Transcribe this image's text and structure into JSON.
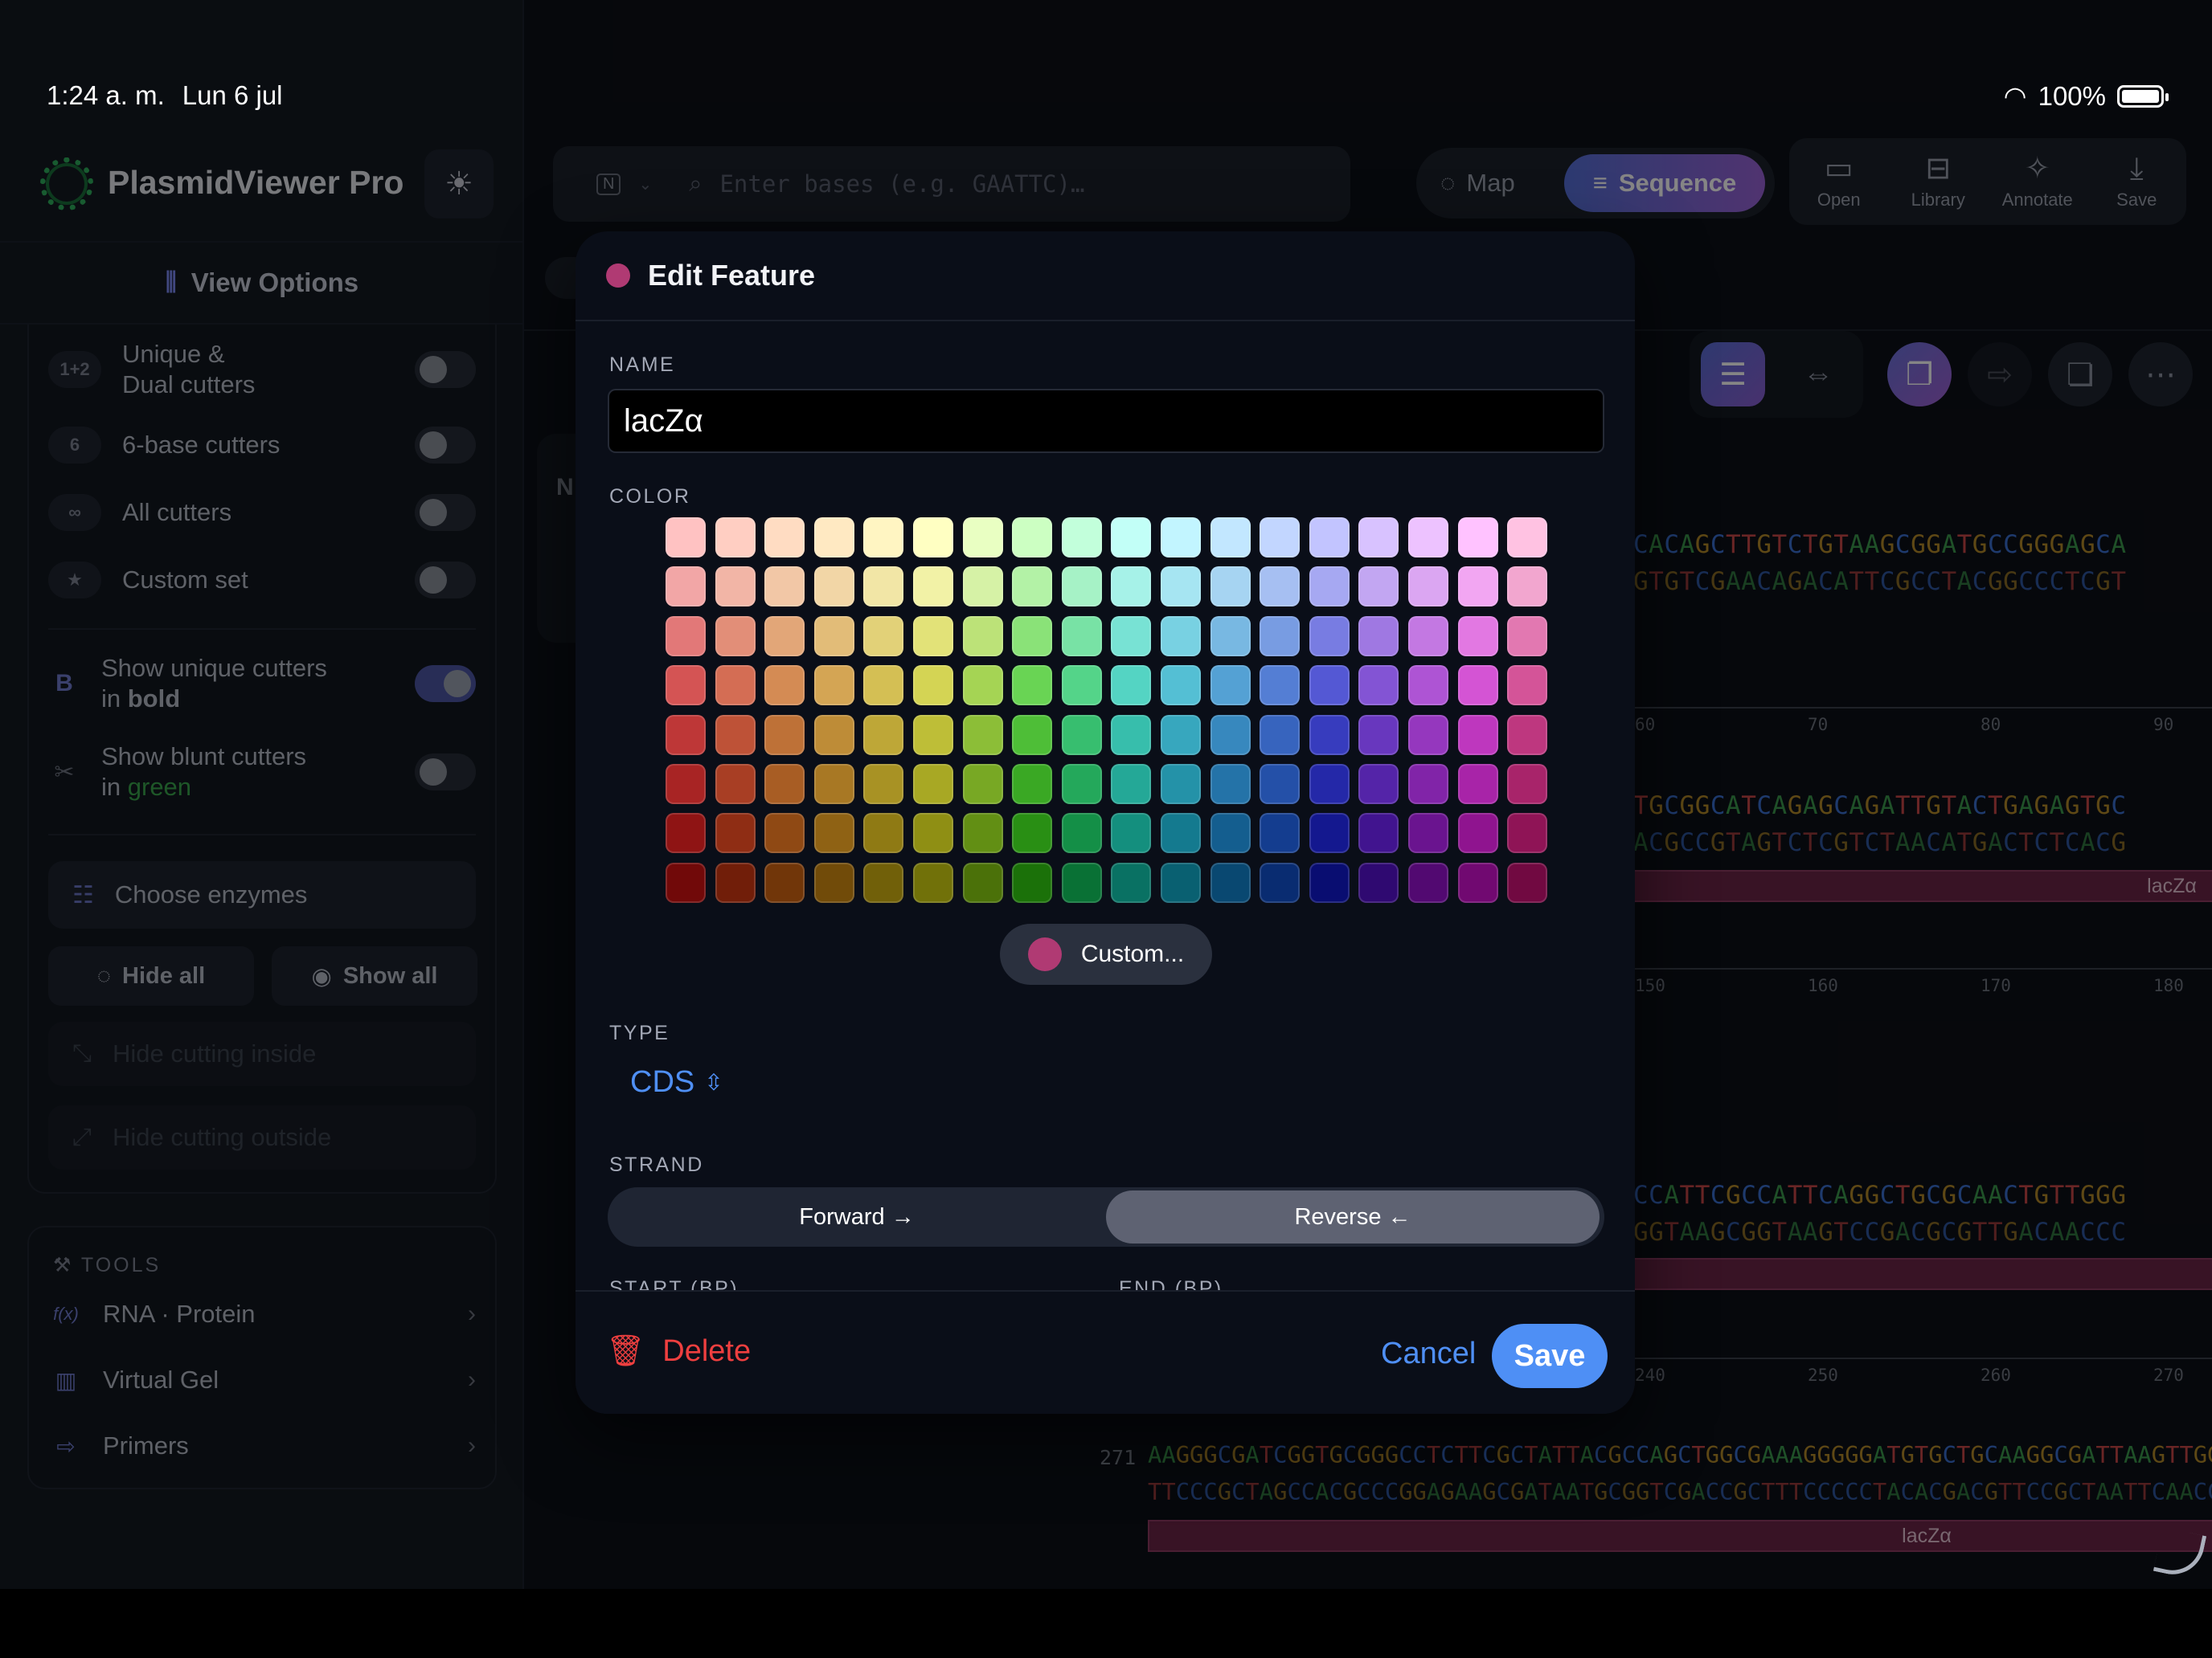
{
  "status_bar": {
    "time": "1:24 a. m.",
    "date": "Lun 6 jul",
    "battery": "100%"
  },
  "app": {
    "title": "PlasmidViewer Pro"
  },
  "sidebar": {
    "view_options": "View Options",
    "cutters": [
      {
        "badge": "1+2",
        "label1": "Unique &",
        "label2": "Dual cutters",
        "on": false
      },
      {
        "badge": "6",
        "label1": "6-base cutters",
        "label2": "",
        "on": false
      },
      {
        "badge": "∞",
        "label1": "All cutters",
        "label2": "",
        "on": false
      },
      {
        "badge": "★",
        "label1": "Custom set",
        "label2": "",
        "on": false
      }
    ],
    "show_unique": {
      "icon": "B",
      "line1": "Show unique cutters",
      "line2_pre": "in ",
      "line2_em": "bold",
      "on": true
    },
    "show_blunt": {
      "line1": "Show blunt cutters",
      "line2_pre": "in ",
      "line2_em": "green",
      "on": false
    },
    "choose_enzymes": "Choose enzymes",
    "hide_all": "Hide all",
    "show_all": "Show all",
    "hide_inside": "Hide cutting inside",
    "hide_outside": "Hide cutting outside",
    "tools_title": "TOOLS",
    "tools": [
      {
        "icon": "f(x)",
        "label": "RNA · Protein"
      },
      {
        "icon": "▥",
        "label": "Virtual Gel"
      },
      {
        "icon": "⇨",
        "label": "Primers"
      }
    ]
  },
  "toolbar": {
    "search_placeholder": "Enter bases (e.g. GAATTC)…",
    "nucleotide_badge": "N",
    "map": "Map",
    "sequence": "Sequence",
    "open": "Open",
    "library": "Library",
    "annotate": "Annotate",
    "save": "Save"
  },
  "sequence_view": {
    "card_letter": "N",
    "rows": [
      {
        "top": "CACAGCTTGTCTGTAAGCGGATGCCGGGAGCA",
        "bottom": "GTGTCGAACAGACATTCGCCTACGGCCCTCGT",
        "ticks": [
          "60",
          "70",
          "80",
          "90"
        ],
        "feature": ""
      },
      {
        "top": "TGCGGCATCAGAGCAGATTGTACTGAGAGTGC",
        "bottom": "ACGCCGTAGTCTCGTCTAACATGACTCTCACG",
        "ticks": [
          "150",
          "160",
          "170",
          "180"
        ],
        "feature": "lacZα"
      },
      {
        "top": "CCATTCGCCATTCAGGCTGCGCAACTGTTGGG",
        "bottom": "GGTAAGCGGTAAGTCCGACGCGTTGACAACCC",
        "ticks": [
          "240",
          "250",
          "260",
          "270"
        ],
        "feature": ""
      }
    ],
    "last_row": {
      "num": "271",
      "top": "AAGGGCGATCGGTGCGGGCCTCTTCGCTATTACGCCAGCTGGCGAAAGGGGGATGTGCTGCAAGGCGATTAAGTTGGGTAACGCCAGGGT",
      "bottom": "TTCCCGCTAGCCACGCCCGGAGAAGCGATAATGCGGTCGACCGCTTTCCCCCTACACGACGTTCCGCTAATTCAACCCATTGCGGTCCCA",
      "feature": "lacZα"
    }
  },
  "modal": {
    "title": "Edit Feature",
    "name_label": "NAME",
    "name_value": "lacZα",
    "color_label": "COLOR",
    "custom_button": "Custom...",
    "selected_color": "#b03a73",
    "type_label": "TYPE",
    "type_value": "CDS",
    "strand_label": "STRAND",
    "strand_forward": "Forward →",
    "strand_reverse": "Reverse ←",
    "strand_selected": "Reverse",
    "start_label": "START (BP)",
    "end_label": "END (BP)",
    "delete": "Delete",
    "cancel": "Cancel",
    "save": "Save"
  },
  "palette": {
    "hues": [
      0,
      12,
      26,
      38,
      50,
      60,
      82,
      110,
      145,
      172,
      190,
      204,
      220,
      238,
      262,
      282,
      300,
      328
    ],
    "rows": [
      {
        "s": 100,
        "l": 88
      },
      {
        "s": 75,
        "l": 80
      },
      {
        "s": 65,
        "l": 68
      },
      {
        "s": 60,
        "l": 58
      },
      {
        "s": 55,
        "l": 48
      },
      {
        "s": 65,
        "l": 40
      },
      {
        "s": 75,
        "l": 32
      },
      {
        "s": 85,
        "l": 24
      }
    ]
  },
  "colors": {
    "accent": "#4f8ff5",
    "danger": "#ee3f3f",
    "feature": "#b03a73",
    "nt_A": "#3c9a4e",
    "nt_C": "#3b6fd1",
    "nt_G": "#b58a2a",
    "nt_T": "#c94848"
  }
}
